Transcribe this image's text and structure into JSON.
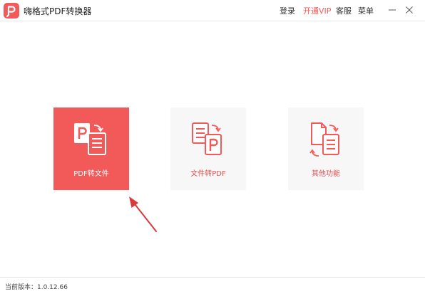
{
  "app": {
    "title": "嗨格式PDF转换器",
    "logo_icon": "pdf-logo-icon"
  },
  "topnav": {
    "login": "登录",
    "vip": "开通VIP",
    "service": "客服",
    "menu": "菜单"
  },
  "window_controls": {
    "minimize_icon": "minimize-icon",
    "close_icon": "close-icon"
  },
  "cards": [
    {
      "label": "PDF转文件",
      "icon": "pdf-to-file-icon",
      "selected": true
    },
    {
      "label": "文件转PDF",
      "icon": "file-to-pdf-icon",
      "selected": false
    },
    {
      "label": "其他功能",
      "icon": "other-functions-icon",
      "selected": false
    }
  ],
  "footer": {
    "version": "当前版本：1.0.12.66"
  },
  "colors": {
    "accent": "#f25a5a",
    "card_background": "#f7f7f7",
    "annotation_arrow": "#d93a3a"
  }
}
